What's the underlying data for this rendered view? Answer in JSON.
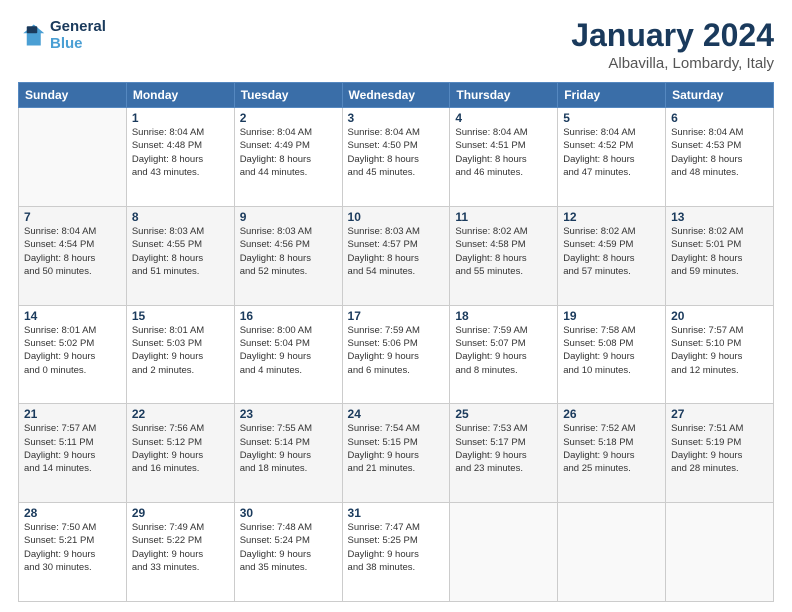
{
  "logo": {
    "line1": "General",
    "line2": "Blue"
  },
  "title": "January 2024",
  "subtitle": "Albavilla, Lombardy, Italy",
  "days_header": [
    "Sunday",
    "Monday",
    "Tuesday",
    "Wednesday",
    "Thursday",
    "Friday",
    "Saturday"
  ],
  "weeks": [
    [
      {
        "day": "",
        "info": ""
      },
      {
        "day": "1",
        "info": "Sunrise: 8:04 AM\nSunset: 4:48 PM\nDaylight: 8 hours\nand 43 minutes."
      },
      {
        "day": "2",
        "info": "Sunrise: 8:04 AM\nSunset: 4:49 PM\nDaylight: 8 hours\nand 44 minutes."
      },
      {
        "day": "3",
        "info": "Sunrise: 8:04 AM\nSunset: 4:50 PM\nDaylight: 8 hours\nand 45 minutes."
      },
      {
        "day": "4",
        "info": "Sunrise: 8:04 AM\nSunset: 4:51 PM\nDaylight: 8 hours\nand 46 minutes."
      },
      {
        "day": "5",
        "info": "Sunrise: 8:04 AM\nSunset: 4:52 PM\nDaylight: 8 hours\nand 47 minutes."
      },
      {
        "day": "6",
        "info": "Sunrise: 8:04 AM\nSunset: 4:53 PM\nDaylight: 8 hours\nand 48 minutes."
      }
    ],
    [
      {
        "day": "7",
        "info": "Sunrise: 8:04 AM\nSunset: 4:54 PM\nDaylight: 8 hours\nand 50 minutes."
      },
      {
        "day": "8",
        "info": "Sunrise: 8:03 AM\nSunset: 4:55 PM\nDaylight: 8 hours\nand 51 minutes."
      },
      {
        "day": "9",
        "info": "Sunrise: 8:03 AM\nSunset: 4:56 PM\nDaylight: 8 hours\nand 52 minutes."
      },
      {
        "day": "10",
        "info": "Sunrise: 8:03 AM\nSunset: 4:57 PM\nDaylight: 8 hours\nand 54 minutes."
      },
      {
        "day": "11",
        "info": "Sunrise: 8:02 AM\nSunset: 4:58 PM\nDaylight: 8 hours\nand 55 minutes."
      },
      {
        "day": "12",
        "info": "Sunrise: 8:02 AM\nSunset: 4:59 PM\nDaylight: 8 hours\nand 57 minutes."
      },
      {
        "day": "13",
        "info": "Sunrise: 8:02 AM\nSunset: 5:01 PM\nDaylight: 8 hours\nand 59 minutes."
      }
    ],
    [
      {
        "day": "14",
        "info": "Sunrise: 8:01 AM\nSunset: 5:02 PM\nDaylight: 9 hours\nand 0 minutes."
      },
      {
        "day": "15",
        "info": "Sunrise: 8:01 AM\nSunset: 5:03 PM\nDaylight: 9 hours\nand 2 minutes."
      },
      {
        "day": "16",
        "info": "Sunrise: 8:00 AM\nSunset: 5:04 PM\nDaylight: 9 hours\nand 4 minutes."
      },
      {
        "day": "17",
        "info": "Sunrise: 7:59 AM\nSunset: 5:06 PM\nDaylight: 9 hours\nand 6 minutes."
      },
      {
        "day": "18",
        "info": "Sunrise: 7:59 AM\nSunset: 5:07 PM\nDaylight: 9 hours\nand 8 minutes."
      },
      {
        "day": "19",
        "info": "Sunrise: 7:58 AM\nSunset: 5:08 PM\nDaylight: 9 hours\nand 10 minutes."
      },
      {
        "day": "20",
        "info": "Sunrise: 7:57 AM\nSunset: 5:10 PM\nDaylight: 9 hours\nand 12 minutes."
      }
    ],
    [
      {
        "day": "21",
        "info": "Sunrise: 7:57 AM\nSunset: 5:11 PM\nDaylight: 9 hours\nand 14 minutes."
      },
      {
        "day": "22",
        "info": "Sunrise: 7:56 AM\nSunset: 5:12 PM\nDaylight: 9 hours\nand 16 minutes."
      },
      {
        "day": "23",
        "info": "Sunrise: 7:55 AM\nSunset: 5:14 PM\nDaylight: 9 hours\nand 18 minutes."
      },
      {
        "day": "24",
        "info": "Sunrise: 7:54 AM\nSunset: 5:15 PM\nDaylight: 9 hours\nand 21 minutes."
      },
      {
        "day": "25",
        "info": "Sunrise: 7:53 AM\nSunset: 5:17 PM\nDaylight: 9 hours\nand 23 minutes."
      },
      {
        "day": "26",
        "info": "Sunrise: 7:52 AM\nSunset: 5:18 PM\nDaylight: 9 hours\nand 25 minutes."
      },
      {
        "day": "27",
        "info": "Sunrise: 7:51 AM\nSunset: 5:19 PM\nDaylight: 9 hours\nand 28 minutes."
      }
    ],
    [
      {
        "day": "28",
        "info": "Sunrise: 7:50 AM\nSunset: 5:21 PM\nDaylight: 9 hours\nand 30 minutes."
      },
      {
        "day": "29",
        "info": "Sunrise: 7:49 AM\nSunset: 5:22 PM\nDaylight: 9 hours\nand 33 minutes."
      },
      {
        "day": "30",
        "info": "Sunrise: 7:48 AM\nSunset: 5:24 PM\nDaylight: 9 hours\nand 35 minutes."
      },
      {
        "day": "31",
        "info": "Sunrise: 7:47 AM\nSunset: 5:25 PM\nDaylight: 9 hours\nand 38 minutes."
      },
      {
        "day": "",
        "info": ""
      },
      {
        "day": "",
        "info": ""
      },
      {
        "day": "",
        "info": ""
      }
    ]
  ]
}
